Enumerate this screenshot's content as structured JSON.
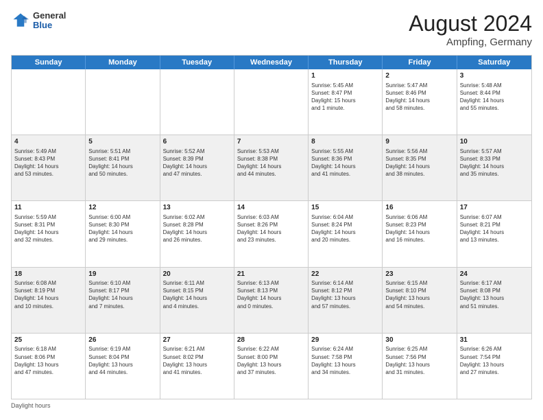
{
  "header": {
    "logo": {
      "general": "General",
      "blue": "Blue"
    },
    "month_year": "August 2024",
    "location": "Ampfing, Germany"
  },
  "days_of_week": [
    "Sunday",
    "Monday",
    "Tuesday",
    "Wednesday",
    "Thursday",
    "Friday",
    "Saturday"
  ],
  "weeks": [
    [
      {
        "day": "",
        "content": ""
      },
      {
        "day": "",
        "content": ""
      },
      {
        "day": "",
        "content": ""
      },
      {
        "day": "",
        "content": ""
      },
      {
        "day": "1",
        "content": "Sunrise: 5:45 AM\nSunset: 8:47 PM\nDaylight: 15 hours\nand 1 minute."
      },
      {
        "day": "2",
        "content": "Sunrise: 5:47 AM\nSunset: 8:46 PM\nDaylight: 14 hours\nand 58 minutes."
      },
      {
        "day": "3",
        "content": "Sunrise: 5:48 AM\nSunset: 8:44 PM\nDaylight: 14 hours\nand 55 minutes."
      }
    ],
    [
      {
        "day": "4",
        "content": "Sunrise: 5:49 AM\nSunset: 8:43 PM\nDaylight: 14 hours\nand 53 minutes."
      },
      {
        "day": "5",
        "content": "Sunrise: 5:51 AM\nSunset: 8:41 PM\nDaylight: 14 hours\nand 50 minutes."
      },
      {
        "day": "6",
        "content": "Sunrise: 5:52 AM\nSunset: 8:39 PM\nDaylight: 14 hours\nand 47 minutes."
      },
      {
        "day": "7",
        "content": "Sunrise: 5:53 AM\nSunset: 8:38 PM\nDaylight: 14 hours\nand 44 minutes."
      },
      {
        "day": "8",
        "content": "Sunrise: 5:55 AM\nSunset: 8:36 PM\nDaylight: 14 hours\nand 41 minutes."
      },
      {
        "day": "9",
        "content": "Sunrise: 5:56 AM\nSunset: 8:35 PM\nDaylight: 14 hours\nand 38 minutes."
      },
      {
        "day": "10",
        "content": "Sunrise: 5:57 AM\nSunset: 8:33 PM\nDaylight: 14 hours\nand 35 minutes."
      }
    ],
    [
      {
        "day": "11",
        "content": "Sunrise: 5:59 AM\nSunset: 8:31 PM\nDaylight: 14 hours\nand 32 minutes."
      },
      {
        "day": "12",
        "content": "Sunrise: 6:00 AM\nSunset: 8:30 PM\nDaylight: 14 hours\nand 29 minutes."
      },
      {
        "day": "13",
        "content": "Sunrise: 6:02 AM\nSunset: 8:28 PM\nDaylight: 14 hours\nand 26 minutes."
      },
      {
        "day": "14",
        "content": "Sunrise: 6:03 AM\nSunset: 8:26 PM\nDaylight: 14 hours\nand 23 minutes."
      },
      {
        "day": "15",
        "content": "Sunrise: 6:04 AM\nSunset: 8:24 PM\nDaylight: 14 hours\nand 20 minutes."
      },
      {
        "day": "16",
        "content": "Sunrise: 6:06 AM\nSunset: 8:23 PM\nDaylight: 14 hours\nand 16 minutes."
      },
      {
        "day": "17",
        "content": "Sunrise: 6:07 AM\nSunset: 8:21 PM\nDaylight: 14 hours\nand 13 minutes."
      }
    ],
    [
      {
        "day": "18",
        "content": "Sunrise: 6:08 AM\nSunset: 8:19 PM\nDaylight: 14 hours\nand 10 minutes."
      },
      {
        "day": "19",
        "content": "Sunrise: 6:10 AM\nSunset: 8:17 PM\nDaylight: 14 hours\nand 7 minutes."
      },
      {
        "day": "20",
        "content": "Sunrise: 6:11 AM\nSunset: 8:15 PM\nDaylight: 14 hours\nand 4 minutes."
      },
      {
        "day": "21",
        "content": "Sunrise: 6:13 AM\nSunset: 8:13 PM\nDaylight: 14 hours\nand 0 minutes."
      },
      {
        "day": "22",
        "content": "Sunrise: 6:14 AM\nSunset: 8:12 PM\nDaylight: 13 hours\nand 57 minutes."
      },
      {
        "day": "23",
        "content": "Sunrise: 6:15 AM\nSunset: 8:10 PM\nDaylight: 13 hours\nand 54 minutes."
      },
      {
        "day": "24",
        "content": "Sunrise: 6:17 AM\nSunset: 8:08 PM\nDaylight: 13 hours\nand 51 minutes."
      }
    ],
    [
      {
        "day": "25",
        "content": "Sunrise: 6:18 AM\nSunset: 8:06 PM\nDaylight: 13 hours\nand 47 minutes."
      },
      {
        "day": "26",
        "content": "Sunrise: 6:19 AM\nSunset: 8:04 PM\nDaylight: 13 hours\nand 44 minutes."
      },
      {
        "day": "27",
        "content": "Sunrise: 6:21 AM\nSunset: 8:02 PM\nDaylight: 13 hours\nand 41 minutes."
      },
      {
        "day": "28",
        "content": "Sunrise: 6:22 AM\nSunset: 8:00 PM\nDaylight: 13 hours\nand 37 minutes."
      },
      {
        "day": "29",
        "content": "Sunrise: 6:24 AM\nSunset: 7:58 PM\nDaylight: 13 hours\nand 34 minutes."
      },
      {
        "day": "30",
        "content": "Sunrise: 6:25 AM\nSunset: 7:56 PM\nDaylight: 13 hours\nand 31 minutes."
      },
      {
        "day": "31",
        "content": "Sunrise: 6:26 AM\nSunset: 7:54 PM\nDaylight: 13 hours\nand 27 minutes."
      }
    ]
  ],
  "footer": "Daylight hours"
}
